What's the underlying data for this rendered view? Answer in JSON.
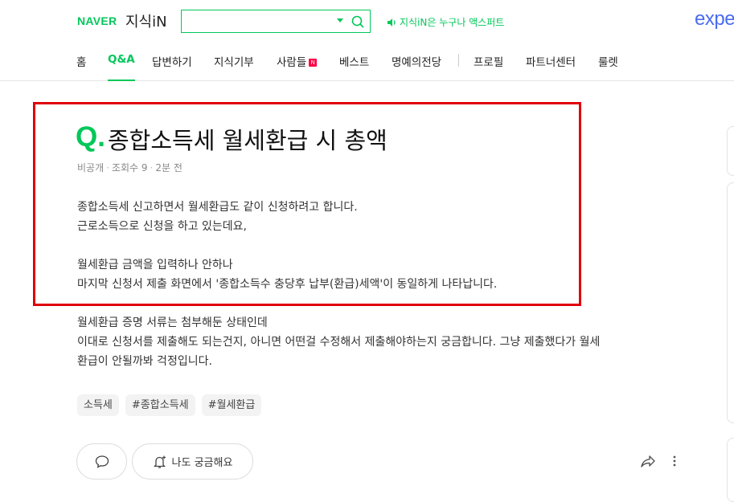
{
  "header": {
    "naver_logo": "NAVER",
    "jisik_logo": "지식iN",
    "search_value": "",
    "promo_text": "지식iN은 누구나 액스퍼트",
    "expert_logo": "expe"
  },
  "nav": {
    "items": [
      "홈",
      "Q&A",
      "답변하기",
      "지식기부",
      "사람들",
      "베스트",
      "명예의전당",
      "프로필",
      "파트너센터",
      "룰렛"
    ],
    "new_badge": "N"
  },
  "question": {
    "q_mark": "Q.",
    "title": "종합소득세 월세환급 시 총액",
    "meta": {
      "visibility": "비공개",
      "views": "조회수 9",
      "time": "2분 전"
    },
    "body": [
      "종합소득세 신고하면서 월세환급도 같이 신청하려고 합니다.",
      "근로소득으로 신청을 하고 있는데요,",
      "",
      "월세환급 금액을 입력하나 안하나",
      "마지막 신청서 제출 화면에서 '종합소득수 충당후 납부(환급)세액'이 동일하게 나타납니다.",
      "",
      "월세환급 증명 서류는 첨부해둔 상태인데",
      "이대로 신청서를 제출해도 되는건지, 아니면 어떤걸 수정해서 제출해야하는지 궁금합니다. 그냥 제출했다가 월세",
      "환급이 안될까봐 걱정입니다."
    ],
    "tags": [
      "소득세",
      "#종합소득세",
      "#월세환급"
    ]
  },
  "actions": {
    "curious_label": "나도 궁금해요"
  },
  "colors": {
    "brand_green": "#03c75a",
    "highlight_red": "#e0000a",
    "expert_blue": "#4a6cf0"
  }
}
